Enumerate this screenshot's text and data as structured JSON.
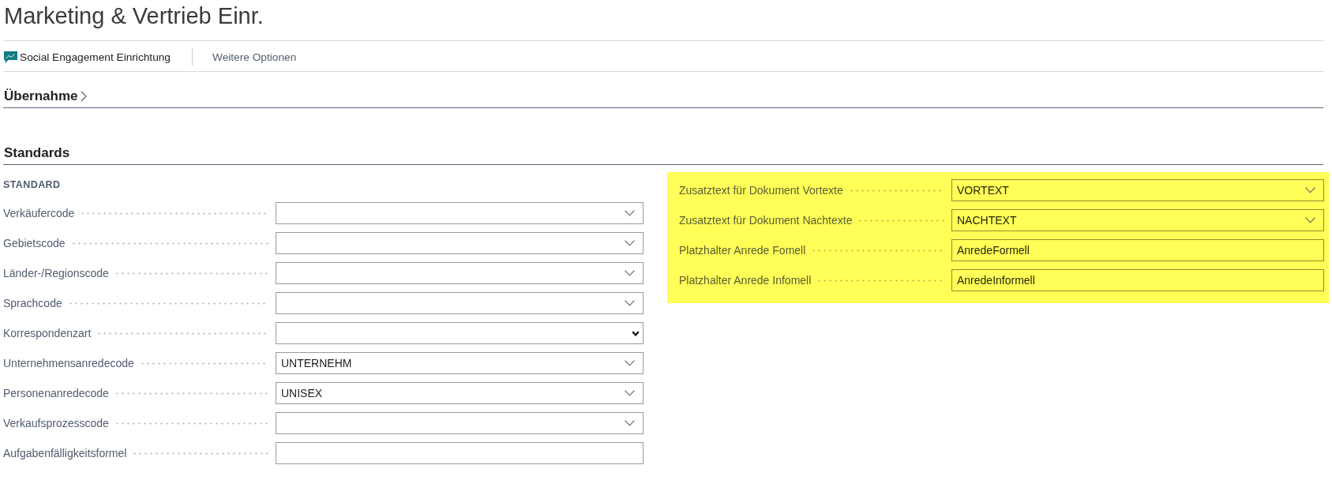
{
  "page": {
    "title": "Marketing & Vertrieb Einr."
  },
  "actions": [
    {
      "label": "Social Engagement Einrichtung",
      "kind": "icon-action"
    },
    {
      "label": "Weitere Optionen",
      "kind": "more"
    }
  ],
  "sections": [
    {
      "title": "Übernahme",
      "expanded": false
    },
    {
      "title": "Standards",
      "expanded": true,
      "groups": [
        {
          "title": "STANDARD",
          "fields": [
            {
              "label": "Verkäufercode",
              "kind": "lookup"
            },
            {
              "label": "Gebietscode",
              "kind": "lookup"
            },
            {
              "label": "Länder-/Regionscode",
              "kind": "lookup"
            },
            {
              "label": "Sprachcode",
              "kind": "lookup"
            },
            {
              "label": "Korrespondenzart",
              "kind": "option"
            },
            {
              "label": "Unternehmensanredecode",
              "kind": "lookup",
              "value": "UNTERNEHM"
            },
            {
              "label": "Personenanredecode",
              "kind": "lookup",
              "value": "UNISEX"
            },
            {
              "label": "Verkaufsprozesscode",
              "kind": "lookup"
            },
            {
              "label": "Aufgabenfälligkeitsformel",
              "kind": "text"
            }
          ]
        },
        {
          "highlighted": true,
          "fields": [
            {
              "label": "Zusatztext für Dokument Vortexte",
              "kind": "lookup",
              "value": "VORTEXT"
            },
            {
              "label": "Zusatztext für Dokument Nachtexte",
              "kind": "lookup",
              "value": "NACHTEXT"
            },
            {
              "label": "Platzhalter Anrede Fomell",
              "kind": "text",
              "value": "AnredeFormell"
            },
            {
              "label": "Platzhalter Anrede Infomell",
              "kind": "text",
              "value": "AnredeInformell"
            }
          ]
        }
      ]
    }
  ]
}
